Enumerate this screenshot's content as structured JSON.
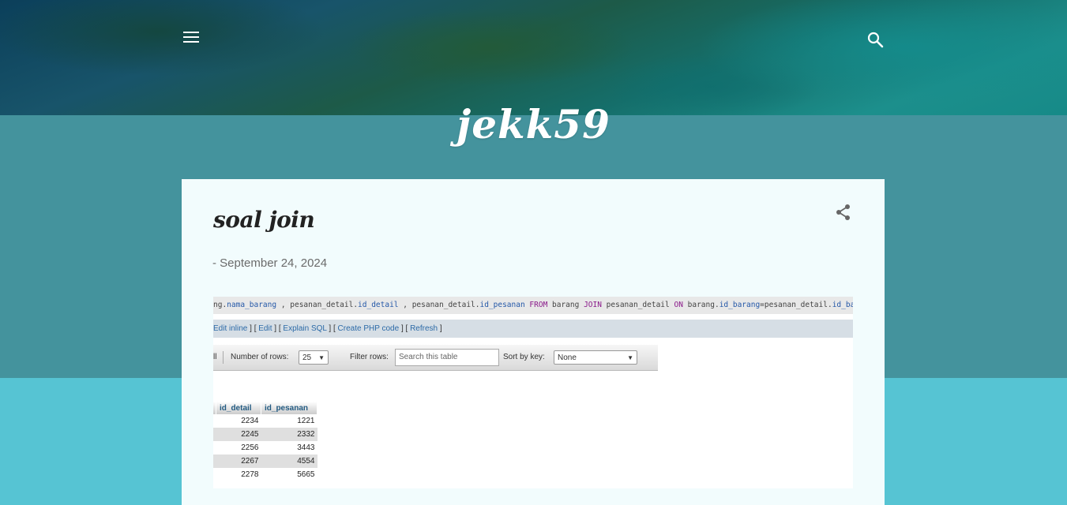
{
  "blog": {
    "title": "jekk59"
  },
  "header": {
    "menu_icon": "menu-icon",
    "search_icon": "search-icon"
  },
  "post": {
    "title": "soal join",
    "date": "- September 24, 2024",
    "share_icon": "share-icon"
  },
  "screenshot": {
    "sql": {
      "p1": "ng.",
      "p2": "nama_barang",
      "p3": " , pesanan_detail.",
      "p4": "id_detail",
      "p5": " , pesanan_detail.",
      "p6": "id_pesanan",
      "p7": " FROM",
      "p8": " barang ",
      "p9": "JOIN",
      "p10": " pesanan_detail ",
      "p11": "ON",
      "p12": " barang.",
      "p13": "id_barang",
      "p14": "=pesanan_detail.",
      "p15": "id_barang"
    },
    "links": {
      "edit_inline": "Edit inline",
      "edit": "Edit",
      "explain": "Explain SQL",
      "php": "Create PHP code",
      "refresh": "Refresh"
    },
    "toolbar": {
      "partial_label": "ll",
      "rows_label": "Number of rows:",
      "rows_value": "25",
      "filter_label": "Filter rows:",
      "search_placeholder": "Search this table",
      "sort_label": "Sort by key:",
      "sort_value": "None"
    },
    "table": {
      "headers": [
        "id_detail",
        "id_pesanan"
      ],
      "rows": [
        [
          "2234",
          "1221"
        ],
        [
          "2245",
          "2332"
        ],
        [
          "2256",
          "3443"
        ],
        [
          "2267",
          "4554"
        ],
        [
          "2278",
          "5665"
        ]
      ]
    }
  }
}
